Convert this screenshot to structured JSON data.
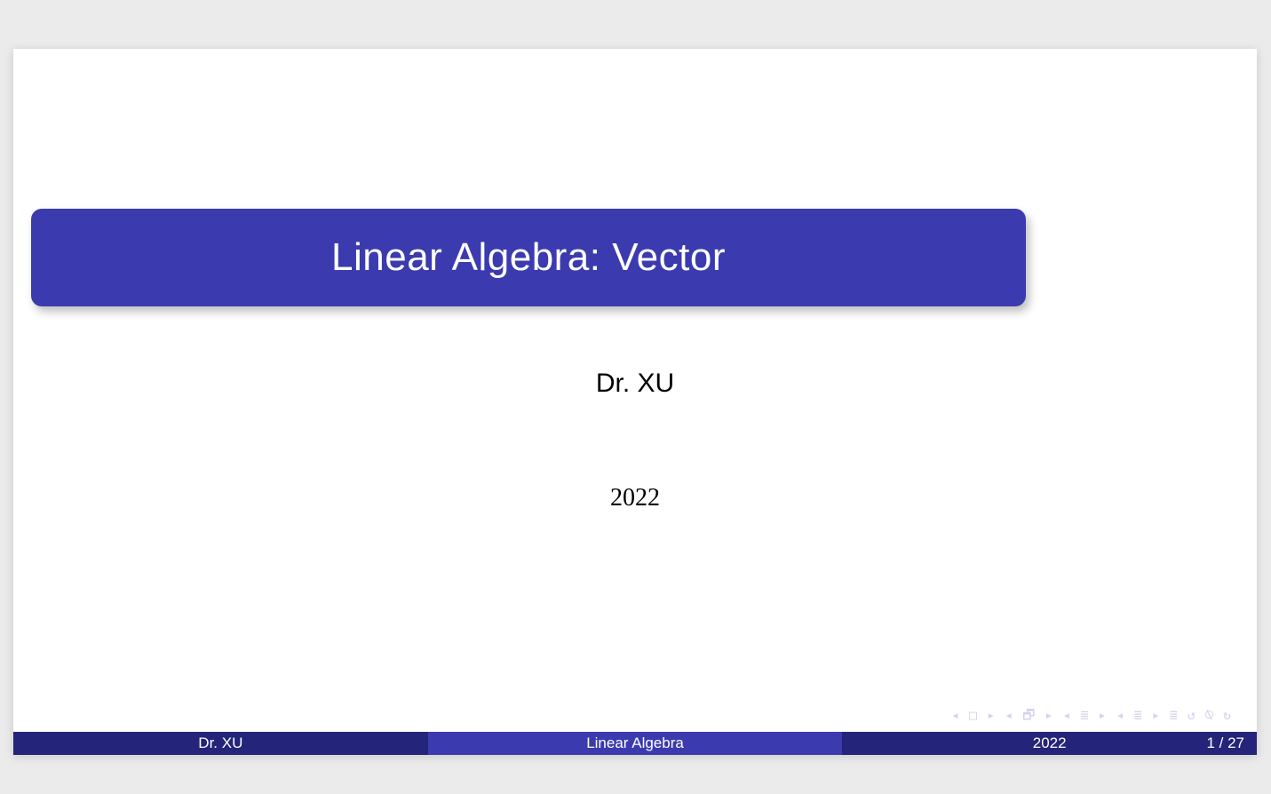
{
  "slide": {
    "title": "Linear Algebra: Vector",
    "author": "Dr. XU",
    "year": "2022"
  },
  "nav": {
    "glyphs": "◂ □ ▸ ◂ 🗗 ▸ ◂ ≣ ▸ ◂ ≣ ▸   ≣   ↺ ⍉ ↻"
  },
  "footer": {
    "left": "Dr. XU",
    "mid": "Linear Algebra",
    "date": "2022",
    "page": "1 / 27"
  }
}
